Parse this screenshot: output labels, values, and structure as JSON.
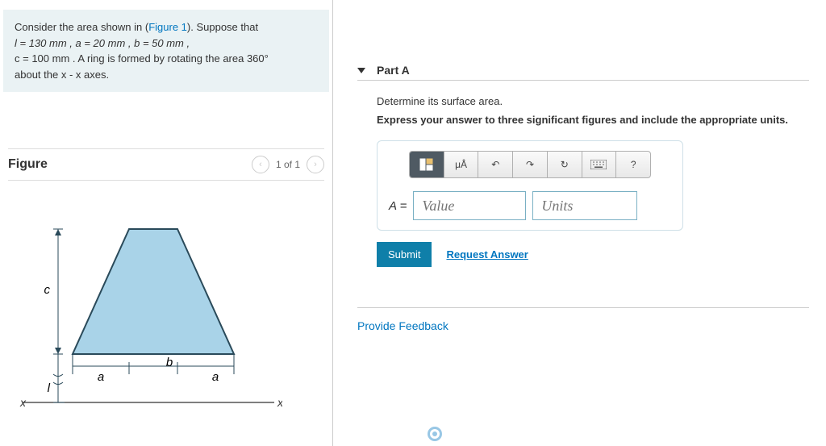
{
  "problem": {
    "line1_prefix": "Consider the area shown in (",
    "figlink": "Figure 1",
    "line1_suffix": "). Suppose that",
    "line2": "l = 130  mm , a = 20  mm , b = 50  mm ,",
    "line3": "c = 100  mm . A ring is formed by rotating the area 360°",
    "line4": "about the x - x axes."
  },
  "figure": {
    "title": "Figure",
    "counter": "1 of 1",
    "labels": {
      "a": "a",
      "b": "b",
      "c": "c",
      "l": "l",
      "x": "x"
    }
  },
  "part": {
    "title": "Part A",
    "instruction": "Determine its surface area.",
    "hint": "Express your answer to three significant figures and include the appropriate units.",
    "eq_label": "A =",
    "value_ph": "Value",
    "units_ph": "Units",
    "toolbar": {
      "units": "μÅ",
      "help": "?"
    }
  },
  "buttons": {
    "submit": "Submit",
    "request": "Request Answer"
  },
  "feedback": "Provide Feedback",
  "chart_data": {
    "type": "diagram",
    "shape": "isoceles trapezoid rotated about x-x axis",
    "parameters": {
      "l": 130,
      "a": 20,
      "b": 50,
      "c": 100,
      "units": "mm",
      "rotation_deg": 360
    }
  }
}
